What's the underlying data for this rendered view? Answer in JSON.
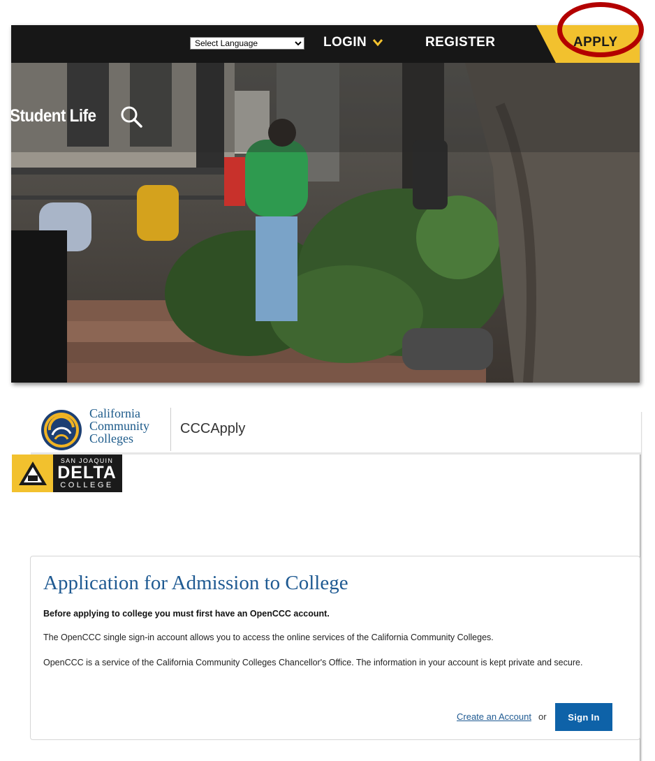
{
  "college_site": {
    "language_select": {
      "selected": "Select Language",
      "options": [
        "Select Language"
      ]
    },
    "nav": {
      "login": "LOGIN",
      "register": "REGISTER",
      "apply": "APPLY"
    },
    "hero": {
      "section_label": "Student Life"
    },
    "colors": {
      "topbar": "#171717",
      "apply_accent": "#f2c12e",
      "highlight_ring": "#b30000"
    }
  },
  "cccapply": {
    "logo_text": [
      "California",
      "Community",
      "Colleges"
    ],
    "app_name": "CCCApply",
    "college_badge": {
      "line1": "SAN JOAQUIN",
      "line2": "DELTA",
      "line3": "COLLEGE"
    },
    "card": {
      "title": "Application for Admission to College",
      "lead": "Before applying to college you must first have an OpenCCC account.",
      "paragraph1": "The OpenCCC single sign-in account allows you to access the online services of the California Community Colleges.",
      "paragraph2": "OpenCCC is a service of the California Community Colleges Chancellor's Office. The information in your account is kept private and secure.",
      "create_account": "Create an Account",
      "or": "or",
      "sign_in": "Sign In"
    },
    "colors": {
      "primary_blue": "#0e62a8",
      "title_blue": "#1f5a92"
    }
  }
}
